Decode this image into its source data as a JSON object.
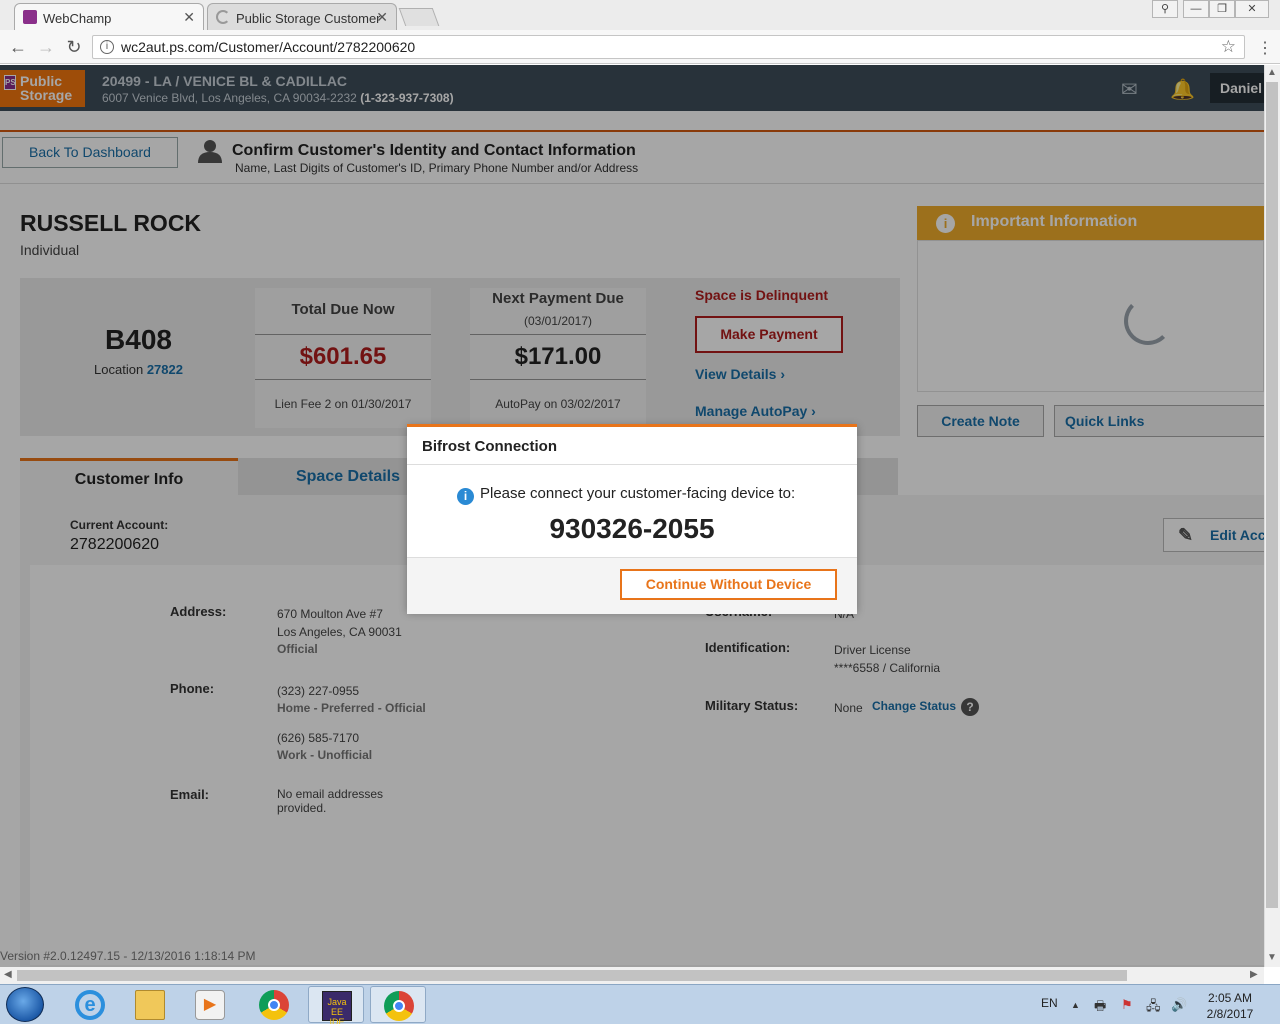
{
  "browser": {
    "tabs": [
      {
        "title": "WebChamp",
        "active": true
      },
      {
        "title": "Public Storage Customer",
        "active": false
      }
    ],
    "url": "wc2aut.ps.com/Customer/Account/2782200620"
  },
  "header": {
    "logo_line1": "Public",
    "logo_line2": "Storage",
    "store_title": "20499 - LA / VENICE BL & CADILLAC",
    "store_address": "6007 Venice Blvd, Los Angeles, CA 90034-2232",
    "store_phone": "(1-323-937-7308)",
    "user": "Daniel"
  },
  "confirm": {
    "back_label": "Back To Dashboard",
    "title": "Confirm Customer's Identity and Contact Information",
    "subtitle": "Name, Last Digits of Customer's ID, Primary Phone Number and/or Address"
  },
  "customer": {
    "name": "RUSSELL ROCK",
    "type": "Individual"
  },
  "summary": {
    "space": "B408",
    "location_label": "Location",
    "location_id": "27822",
    "total_due_label": "Total Due Now",
    "total_due_amount": "$601.65",
    "total_due_note": "Lien Fee 2 on 01/30/2017",
    "next_payment_label": "Next Payment Due",
    "next_payment_date": "(03/01/2017)",
    "next_payment_amount": "$171.00",
    "next_payment_note": "AutoPay on 03/02/2017",
    "delinquent": "Space is Delinquent",
    "make_payment": "Make Payment",
    "view_details": "View Details",
    "manage_autopay": "Manage AutoPay"
  },
  "important": {
    "title": "Important Information",
    "create_note": "Create Note",
    "quick_links": "Quick Links"
  },
  "tabs": [
    {
      "label": "Customer Info",
      "active": true
    },
    {
      "label": "Space Details",
      "active": false
    }
  ],
  "account": {
    "current_label": "Current Account:",
    "current_number": "2782200620",
    "edit_label": "Edit Acc"
  },
  "fields": {
    "address_label": "Address:",
    "address_line1": "670 Moulton Ave #7",
    "address_line2": "Los Angeles, CA 90031",
    "address_tag": "Official",
    "phone_label": "Phone:",
    "phone1": "(323) 227-0955",
    "phone1_tag": "Home - Preferred - Official",
    "phone2": "(626) 585-7170",
    "phone2_tag": "Work - Unofficial",
    "email_label": "Email:",
    "email_line1": "No email addresses",
    "email_line2": "provided.",
    "username_label": "Username:",
    "username_value": "N/A",
    "id_label": "Identification:",
    "id_line1": "Driver License",
    "id_line2": "****6558 / California",
    "military_label": "Military Status:",
    "military_value": "None",
    "change_status": "Change Status"
  },
  "version": "Version #2.0.12497.15 - 12/13/2016 1:18:14 PM",
  "modal": {
    "title": "Bifrost Connection",
    "message": "Please connect your customer-facing device to:",
    "code": "930326-2055",
    "continue_label": "Continue Without Device"
  },
  "taskbar": {
    "language": "EN",
    "time": "2:05 AM",
    "date": "2/8/2017",
    "apps": [
      "start-icon",
      "internet-explorer-icon",
      "file-explorer-icon",
      "media-player-icon",
      "chrome-icon",
      "java-ee-ide-icon",
      "chrome-icon"
    ]
  },
  "colors": {
    "brand_orange": "#f3770f",
    "header_bg": "#3e4d5a",
    "alert_red": "#b01c1c",
    "link_blue": "#1a6fa8",
    "important_gold": "#f0ac2c"
  }
}
